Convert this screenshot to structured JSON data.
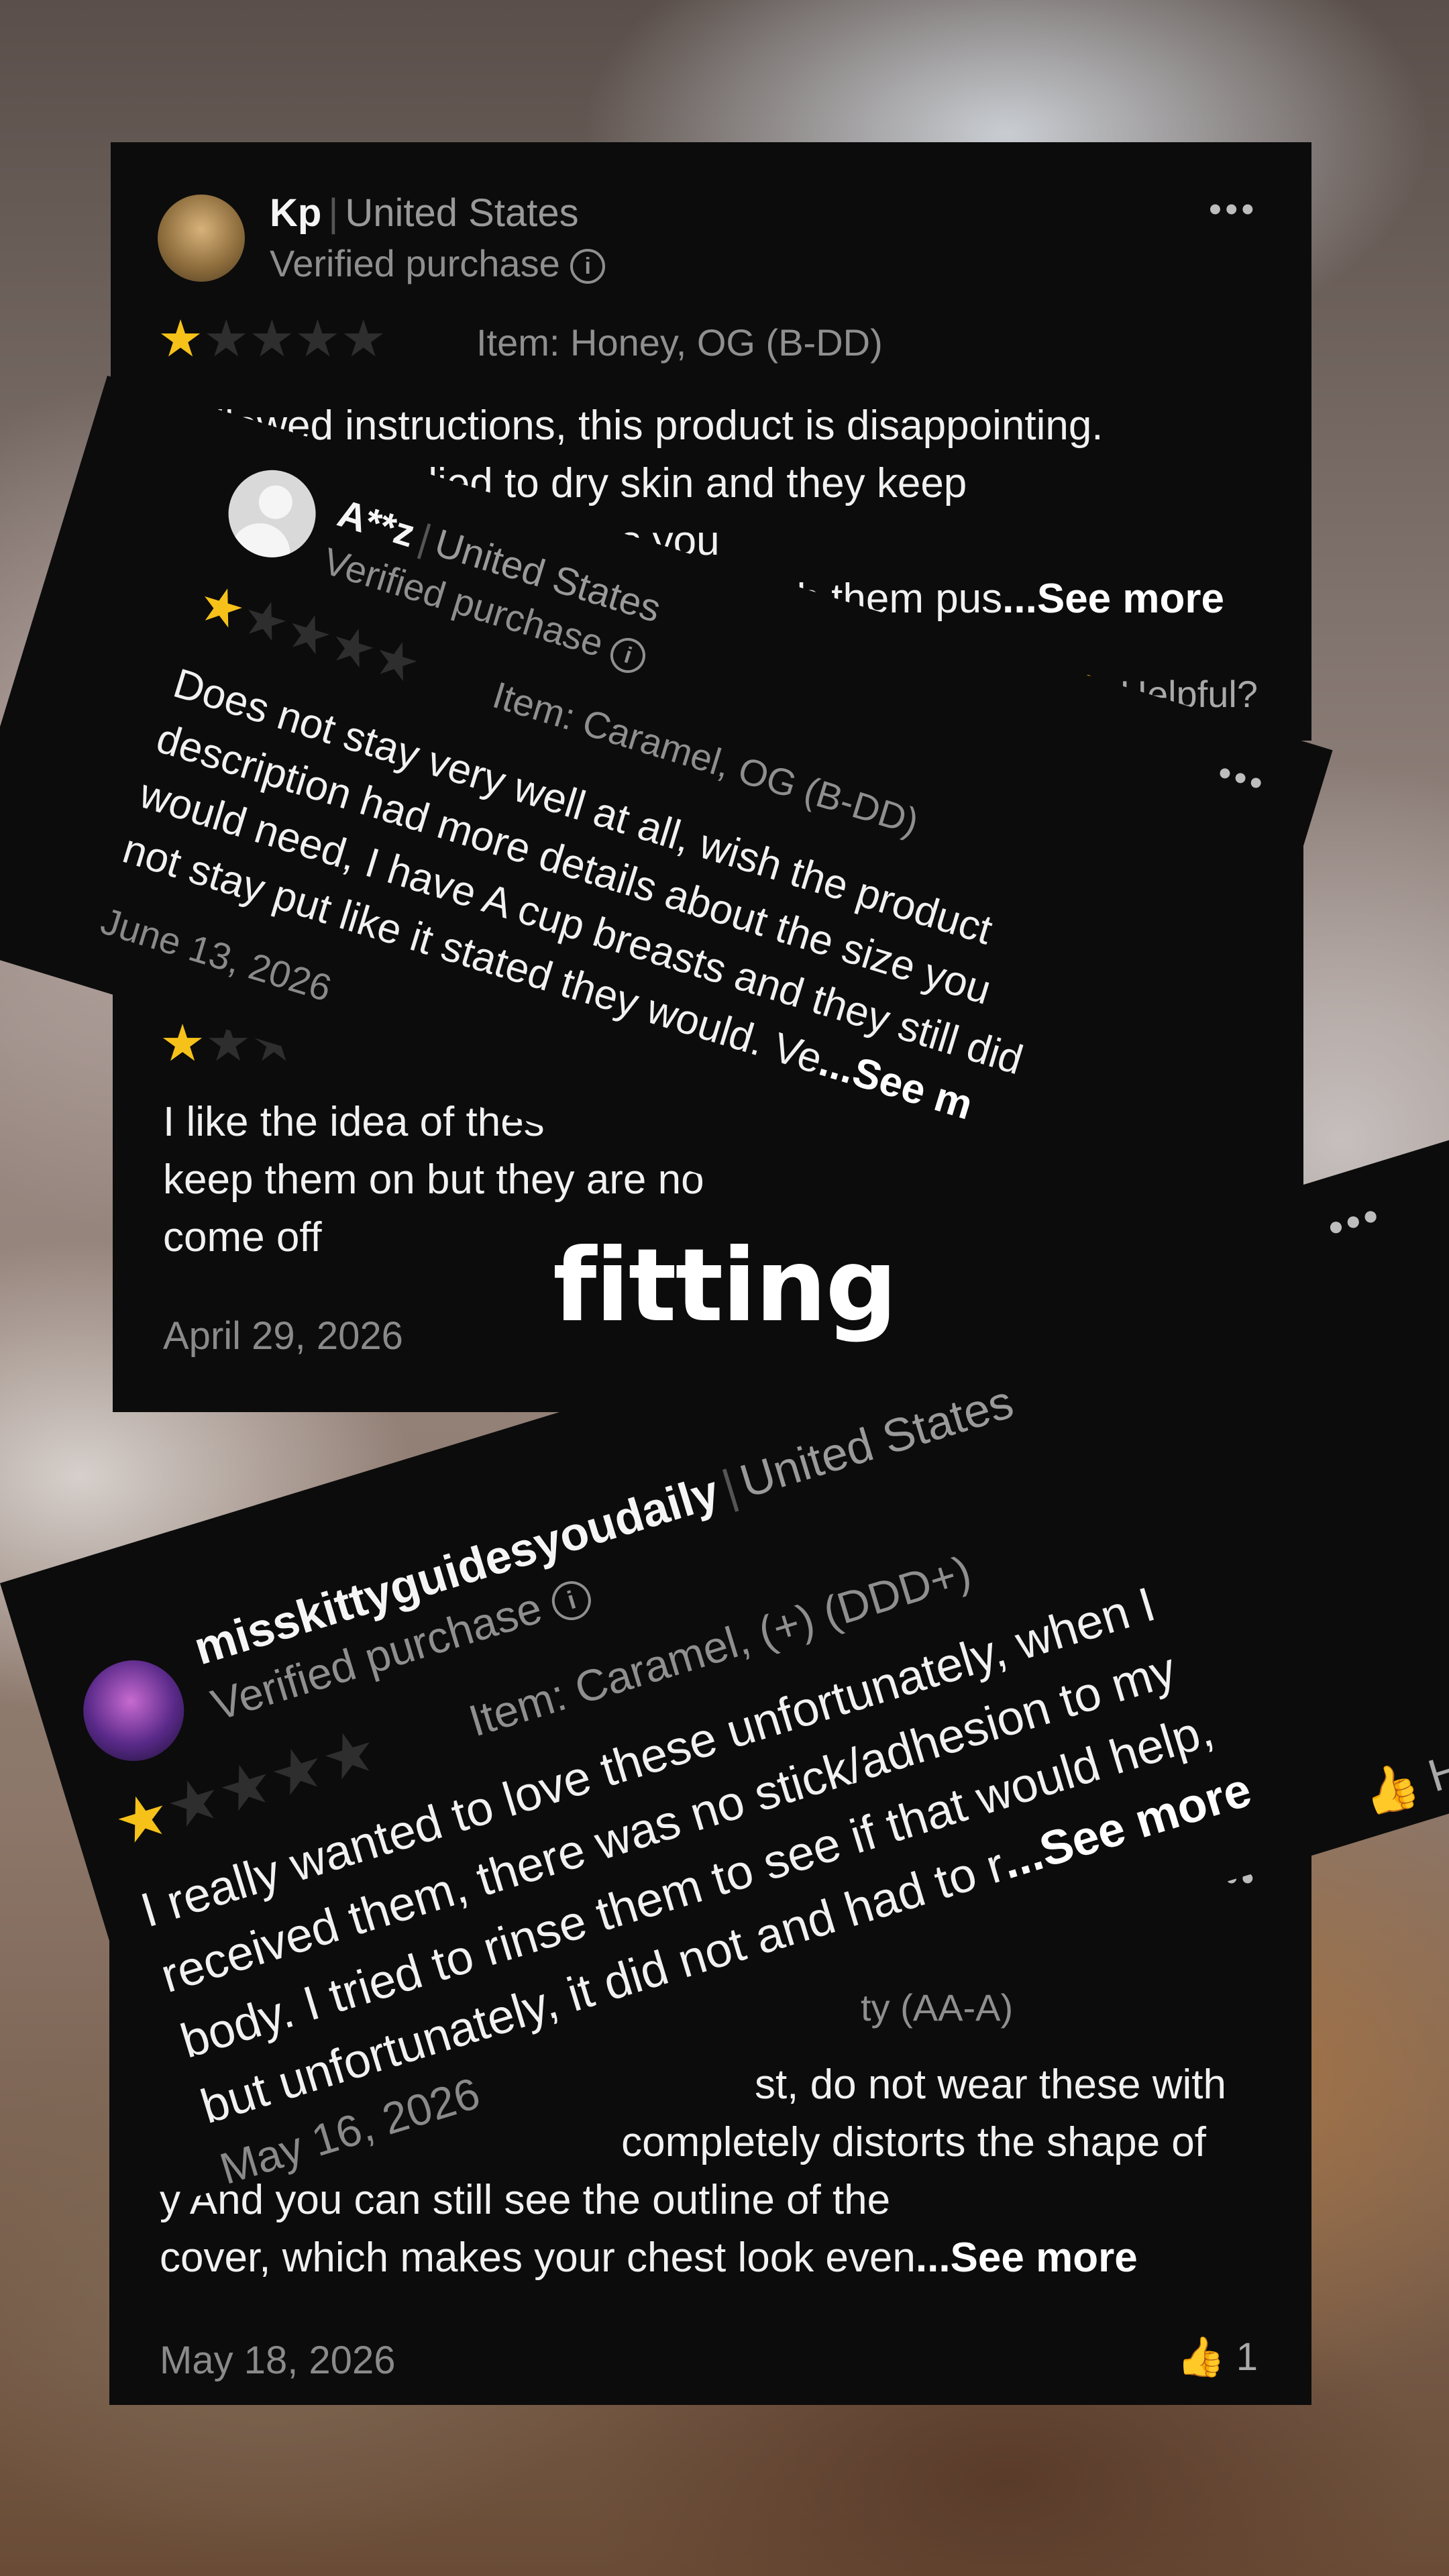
{
  "overlay_caption": "fitting",
  "colors": {
    "star_on": "#f6c21a",
    "star_off": "#2e2e2e",
    "card_bg": "#0c0c0c"
  },
  "reviews": [
    {
      "name": "Kp",
      "country": "United States",
      "verified": "Verified purchase",
      "rating": 1,
      "item": "Item: Honey, OG (B-DD)",
      "text_lines": [
        "I followed instructions, this product is disappointing.",
        "Not water. Applied to dry skin and they keep",
        "fa does not stay on unless you",
        "h them pus"
      ],
      "see_more": "...See more",
      "helpful": "Helpful?",
      "avatar_icon": "photo-avatar"
    },
    {
      "name": "A**z",
      "country": "United States",
      "verified": "Verified purchase",
      "rating": 1,
      "item": "Item: Caramel, OG (B-DD)",
      "text_lines": [
        "Does not stay very well at all, wish the product",
        "description had more details about the size you",
        "would need, I have A cup breasts and they still did",
        "not stay put like it stated they would. Ve"
      ],
      "see_more": "...See m",
      "date": "June 13, 2026",
      "avatar_icon": "default-user-avatar"
    },
    {
      "rating": 1,
      "text_lines": [
        "I like the idea of thes",
        "keep them on but they are no",
        "come off"
      ],
      "date": "April 29, 2026"
    },
    {
      "name": "misskittyguidesyoudaily",
      "country": "United States",
      "verified": "Verified purchase",
      "rating": 1,
      "item": "Item: Caramel, (+) (DDD+)",
      "text_lines": [
        "I really wanted to love these unfortunately, when I",
        "received them, there was no stick/adhesion to my",
        "body. I tried to rinse them to see if that would help,",
        "but unfortunately, it did not and had to r"
      ],
      "see_more": "...See more",
      "helpful": "Helpful",
      "date": "May 16, 2026",
      "avatar_icon": "photo-avatar"
    },
    {
      "item_partial": "ty (AA-A)",
      "text_lines": [
        "st, do not wear these with",
        "completely distorts the shape of",
        "y And you can still see the outline of the",
        "cover, which makes your chest look even"
      ],
      "see_more": "...See more",
      "date": "May 18, 2026",
      "helpful_count": "1"
    }
  ]
}
